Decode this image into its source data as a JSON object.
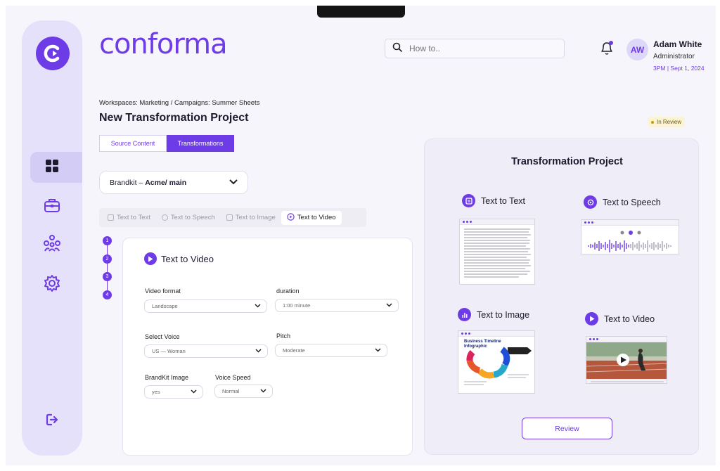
{
  "brand": {
    "name": "conforma"
  },
  "search": {
    "placeholder": "How to.."
  },
  "user": {
    "initials": "AW",
    "name": "Adam White",
    "role": "Administrator",
    "timestamp": "3PM | Sept 1, 2024"
  },
  "sidebar": {
    "items": [
      {
        "icon": "dashboard-icon",
        "active": true
      },
      {
        "icon": "briefcase-icon",
        "active": false
      },
      {
        "icon": "team-icon",
        "active": false
      },
      {
        "icon": "gear-icon",
        "active": false
      }
    ],
    "logout_icon": "logout-icon"
  },
  "breadcrumb": "Workspaces: Marketing / Campaigns: Summer Sheets",
  "page_title": "New Transformation Project",
  "status": "In Review",
  "tabs": [
    {
      "label": "Source Content",
      "active": false
    },
    {
      "label": "Transformations",
      "active": true
    }
  ],
  "brandkit": {
    "prefix": "Brandkit – ",
    "value": "Acme/ main"
  },
  "transform_tabs": [
    {
      "label": "Text to Text",
      "active": false
    },
    {
      "label": "Text to Speech",
      "active": false
    },
    {
      "label": "Text to Image",
      "active": false
    },
    {
      "label": "Text to Video",
      "active": true
    }
  ],
  "steps": [
    "1",
    "2",
    "3",
    "4"
  ],
  "form": {
    "title": "Text to Video",
    "video_format": {
      "label": "Video format",
      "value": "Landscape"
    },
    "duration": {
      "label": "duration",
      "value": "1:00 minute"
    },
    "voice": {
      "label": "Select Voice",
      "value": "US — Woman"
    },
    "pitch": {
      "label": "Pitch",
      "value": "Moderate"
    },
    "brandkit_image": {
      "label": "BrandKit Image",
      "value": "yes"
    },
    "voice_speed": {
      "label": "Voice Speed",
      "value": "Normal"
    }
  },
  "panel": {
    "title": "Transformation Project",
    "items": [
      {
        "label": "Text to Text",
        "icon": "document-icon"
      },
      {
        "label": "Text to Speech",
        "icon": "microphone-icon"
      },
      {
        "label": "Text to Image",
        "icon": "image-chart-icon"
      },
      {
        "label": "Text to Video",
        "icon": "play-icon"
      }
    ],
    "infographic_title": "Business Timeline Infographic"
  },
  "review_label": "Review",
  "colors": {
    "accent": "#6e3ce6",
    "sidebar": "#e6e1fa",
    "status_bg": "#fbf4d4"
  }
}
